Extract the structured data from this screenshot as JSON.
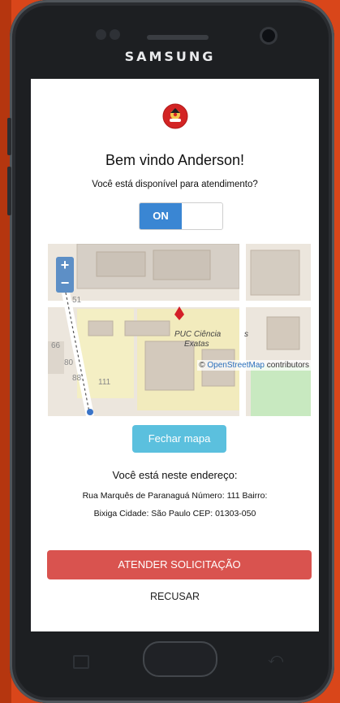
{
  "device": {
    "brand": "SAMSUNG"
  },
  "screen": {
    "logo": {
      "icon": "firefighter-emblem-icon",
      "color": "#d32424"
    },
    "welcome_title": "Bem vindo Anderson!",
    "availability_question": "Você está disponível para atendimento?",
    "toggle": {
      "on_label": "ON",
      "state": "on",
      "accent": "#3a86d3"
    },
    "map": {
      "zoom_in": "+",
      "zoom_out": "−",
      "place_label_line1": "PUC Ciência",
      "place_label_line2": "Exatas",
      "place_label_suffix": "s",
      "street_numbers": [
        "51",
        "66",
        "80",
        "88",
        "111"
      ],
      "attribution_prefix": "©",
      "attribution_link": "OpenStreetMap",
      "attribution_suffix": "contributors"
    },
    "close_map_button": "Fechar mapa",
    "address_heading": "Você está neste endereço:",
    "address_line1": "Rua Marquês de Paranaguá Número: 111 Bairro:",
    "address_line2": "Bixiga Cidade: São Paulo CEP: 01303-050",
    "accept_button": "ATENDER SOLICITAÇÃO",
    "decline_button": "RECUSAR"
  },
  "colors": {
    "background": "#d9461a",
    "info_button": "#5bc0de",
    "danger_button": "#d9534f"
  }
}
